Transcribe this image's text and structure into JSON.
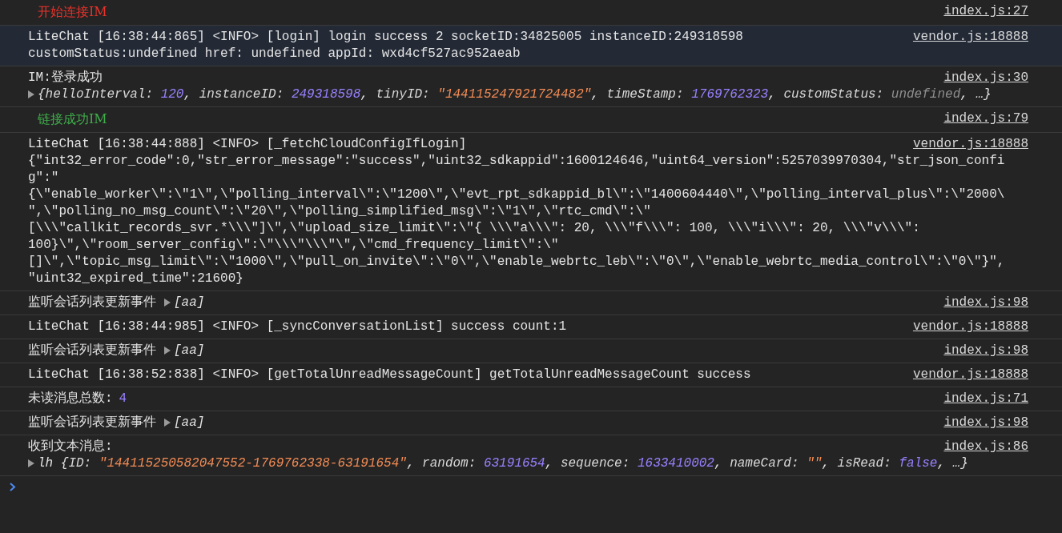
{
  "console": {
    "entries": [
      {
        "kind": "styled",
        "color": "#e8332b",
        "highlighted": false,
        "text": "开始连接IM",
        "source": "index.js:27"
      },
      {
        "kind": "log",
        "highlighted": true,
        "lines": [
          "LiteChat [16:38:44:865] <INFO> [login] login success 2 socketID:34825005 instanceID:249318598",
          "customStatus:undefined href: undefined appId: wxd4cf527ac952aeab"
        ],
        "source": "vendor.js:18888"
      },
      {
        "kind": "object",
        "highlighted": false,
        "text": "IM:登录成功",
        "expanded": false,
        "tokens": [
          {
            "text": "{",
            "kind": "punct"
          },
          {
            "text": "helloInterval: ",
            "kind": "key"
          },
          {
            "text": "120",
            "kind": "number"
          },
          {
            "text": ", ",
            "kind": "punct"
          },
          {
            "text": "instanceID: ",
            "kind": "key"
          },
          {
            "text": "249318598",
            "kind": "number"
          },
          {
            "text": ", ",
            "kind": "punct"
          },
          {
            "text": "tinyID: ",
            "kind": "key"
          },
          {
            "text": "\"144115247921724482\"",
            "kind": "string"
          },
          {
            "text": ", ",
            "kind": "punct"
          },
          {
            "text": "timeStamp: ",
            "kind": "key"
          },
          {
            "text": "1769762323",
            "kind": "number"
          },
          {
            "text": ", ",
            "kind": "punct"
          },
          {
            "text": "customStatus: ",
            "kind": "key"
          },
          {
            "text": "undefined",
            "kind": "undefined"
          },
          {
            "text": ", …}",
            "kind": "punct"
          }
        ],
        "source": "index.js:30"
      },
      {
        "kind": "styled",
        "color": "#3fae4a",
        "highlighted": false,
        "text": "链接成功IM",
        "source": "index.js:79"
      },
      {
        "kind": "log",
        "highlighted": false,
        "lines": [
          "LiteChat [16:38:44:888] <INFO> [_fetchCloudConfigIfLogin]",
          "{\"int32_error_code\":0,\"str_error_message\":\"success\",\"uint32_sdkappid\":1600124646,\"uint64_version\":5257039970304,\"str_json_confi",
          "g\":\"",
          "{\\\"enable_worker\\\":\\\"1\\\",\\\"polling_interval\\\":\\\"1200\\\",\\\"evt_rpt_sdkappid_bl\\\":\\\"1400604440\\\",\\\"polling_interval_plus\\\":\\\"2000\\",
          "\",\\\"polling_no_msg_count\\\":\\\"20\\\",\\\"polling_simplified_msg\\\":\\\"1\\\",\\\"rtc_cmd\\\":\\\"",
          "[\\\\\\\"callkit_records_svr.*\\\\\\\"]\\\",\\\"upload_size_limit\\\":\\\"{ \\\\\\\"a\\\\\\\": 20, \\\\\\\"f\\\\\\\": 100, \\\\\\\"i\\\\\\\": 20, \\\\\\\"v\\\\\\\":",
          "100}\\\",\\\"room_server_config\\\":\\\"\\\\\\\"\\\\\\\"\\\",\\\"cmd_frequency_limit\\\":\\\"",
          "[]\\\",\\\"topic_msg_limit\\\":\\\"1000\\\",\\\"pull_on_invite\\\":\\\"0\\\",\\\"enable_webrtc_leb\\\":\\\"0\\\",\\\"enable_webrtc_media_control\\\":\\\"0\\\"}\",",
          "\"uint32_expired_time\":21600}"
        ],
        "source": "vendor.js:18888"
      },
      {
        "kind": "inline-object",
        "highlighted": false,
        "text": "监听会话列表更新事件",
        "expanded": false,
        "tokens": [
          {
            "text": "[aa]",
            "kind": "punct"
          }
        ],
        "source": "index.js:98"
      },
      {
        "kind": "log",
        "highlighted": false,
        "lines": [
          "LiteChat [16:38:44:985] <INFO> [_syncConversationList] success count:1"
        ],
        "source": "vendor.js:18888"
      },
      {
        "kind": "inline-object",
        "highlighted": false,
        "text": "监听会话列表更新事件",
        "expanded": false,
        "tokens": [
          {
            "text": "[aa]",
            "kind": "punct"
          }
        ],
        "source": "index.js:98"
      },
      {
        "kind": "log",
        "highlighted": false,
        "lines": [
          "LiteChat [16:38:52:838] <INFO> [getTotalUnreadMessageCount] getTotalUnreadMessageCount success"
        ],
        "source": "vendor.js:18888"
      },
      {
        "kind": "value",
        "highlighted": false,
        "text": "未读消息总数:",
        "tokens": [
          {
            "text": "4",
            "kind": "number"
          }
        ],
        "source": "index.js:71"
      },
      {
        "kind": "inline-object",
        "highlighted": false,
        "text": "监听会话列表更新事件",
        "expanded": false,
        "tokens": [
          {
            "text": "[aa]",
            "kind": "punct"
          }
        ],
        "source": "index.js:98"
      },
      {
        "kind": "object",
        "highlighted": false,
        "text": "收到文本消息:",
        "expanded": false,
        "tokens": [
          {
            "text": "lh {",
            "kind": "punct"
          },
          {
            "text": "ID: ",
            "kind": "key"
          },
          {
            "text": "\"144115250582047552-1769762338-63191654\"",
            "kind": "string"
          },
          {
            "text": ", ",
            "kind": "punct"
          },
          {
            "text": "random: ",
            "kind": "key"
          },
          {
            "text": "63191654",
            "kind": "number"
          },
          {
            "text": ", ",
            "kind": "punct"
          },
          {
            "text": "sequence: ",
            "kind": "key"
          },
          {
            "text": "1633410002",
            "kind": "number"
          },
          {
            "text": ", ",
            "kind": "punct"
          },
          {
            "text": "nameCard: ",
            "kind": "key"
          },
          {
            "text": "\"\"",
            "kind": "string"
          },
          {
            "text": ", ",
            "kind": "punct"
          },
          {
            "text": "isRead: ",
            "kind": "key"
          },
          {
            "text": "false",
            "kind": "boolean"
          },
          {
            "text": ", …}",
            "kind": "punct"
          }
        ],
        "source": "index.js:86"
      }
    ]
  }
}
